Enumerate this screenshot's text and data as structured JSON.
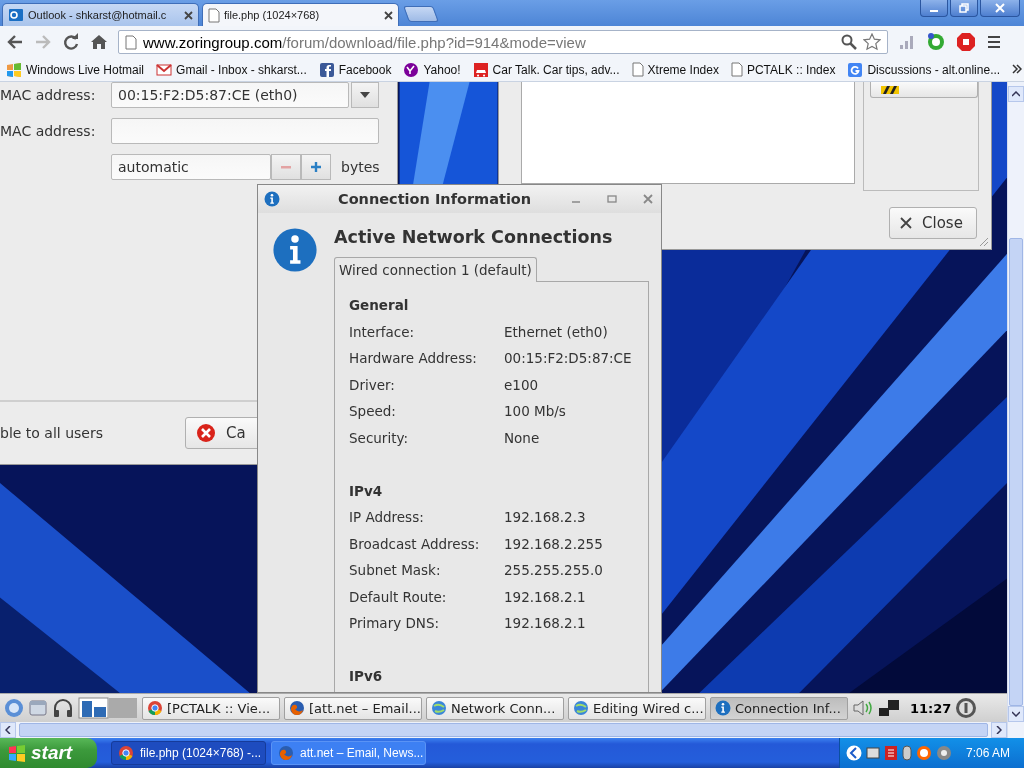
{
  "browser": {
    "tabs": [
      {
        "title": "Outlook - shkarst@hotmail.c",
        "kind": "outlook",
        "selected": false
      },
      {
        "title": "file.php (1024×768)",
        "kind": "page",
        "selected": true
      }
    ],
    "address_bar": {
      "host": "www.zoringroup.com",
      "path": "/forum/download/file.php?id=914&mode=view"
    },
    "bookmarks": [
      {
        "label": "Windows Live Hotmail",
        "kind": "windows"
      },
      {
        "label": "Gmail - Inbox - shkarst...",
        "kind": "gmail"
      },
      {
        "label": "Facebook",
        "kind": "facebook"
      },
      {
        "label": "Yahoo!",
        "kind": "yahoo"
      },
      {
        "label": "Car Talk. Car tips, adv...",
        "kind": "cartalk"
      },
      {
        "label": "Xtreme Index",
        "kind": "page"
      },
      {
        "label": "PCTALK :: Index",
        "kind": "page"
      },
      {
        "label": "Discussions - alt.online...",
        "kind": "google"
      }
    ]
  },
  "editing_window": {
    "mac_label": "MAC address:",
    "mac_value": "00:15:F2:D5:87:CE (eth0)",
    "cloned_mac_label": "MAC address:",
    "mtu_value": "automatic",
    "mtu_minus_disabled": true,
    "mtu_unit": "bytes",
    "all_users_label": "ble to all users",
    "cancel_button": "Ca"
  },
  "network_window": {
    "close_button": "Close"
  },
  "connection_dialog": {
    "title": "Connection Information",
    "heading": "Active Network Connections",
    "tabs": [
      {
        "label": "Wired connection 1 (default)",
        "selected": true
      }
    ],
    "sections": [
      {
        "title": "General",
        "rows": [
          {
            "label": "Interface:",
            "value": "Ethernet (eth0)"
          },
          {
            "label": "Hardware Address:",
            "value": "00:15:F2:D5:87:CE"
          },
          {
            "label": "Driver:",
            "value": "e100"
          },
          {
            "label": "Speed:",
            "value": "100 Mb/s"
          },
          {
            "label": "Security:",
            "value": "None"
          }
        ]
      },
      {
        "title": "IPv4",
        "rows": [
          {
            "label": "IP Address:",
            "value": "192.168.2.3"
          },
          {
            "label": "Broadcast Address:",
            "value": "192.168.2.255"
          },
          {
            "label": "Subnet Mask:",
            "value": "255.255.255.0"
          },
          {
            "label": "Default Route:",
            "value": "192.168.2.1"
          },
          {
            "label": "Primary DNS:",
            "value": "192.168.2.1"
          }
        ]
      },
      {
        "title": "IPv6"
      }
    ]
  },
  "zorin_taskbar": {
    "tasks": [
      {
        "label": "[PCTALK :: Vie...",
        "kind": "chrome",
        "selected": false
      },
      {
        "label": "[att.net – Email...",
        "kind": "firefox",
        "selected": false
      },
      {
        "label": "Network Conn...",
        "kind": "globe",
        "selected": false
      },
      {
        "label": "Editing Wired c...",
        "kind": "globe",
        "selected": false
      },
      {
        "label": "Connection Inf...",
        "kind": "info",
        "selected": true
      }
    ],
    "clock": "11:27"
  },
  "xp_taskbar": {
    "start": "start",
    "tasks": [
      {
        "label": "file.php (1024×768) -...",
        "kind": "chrome",
        "selected": true
      },
      {
        "label": "att.net – Email, News...",
        "kind": "firefox",
        "selected": false
      }
    ],
    "clock": "7:06 AM"
  }
}
